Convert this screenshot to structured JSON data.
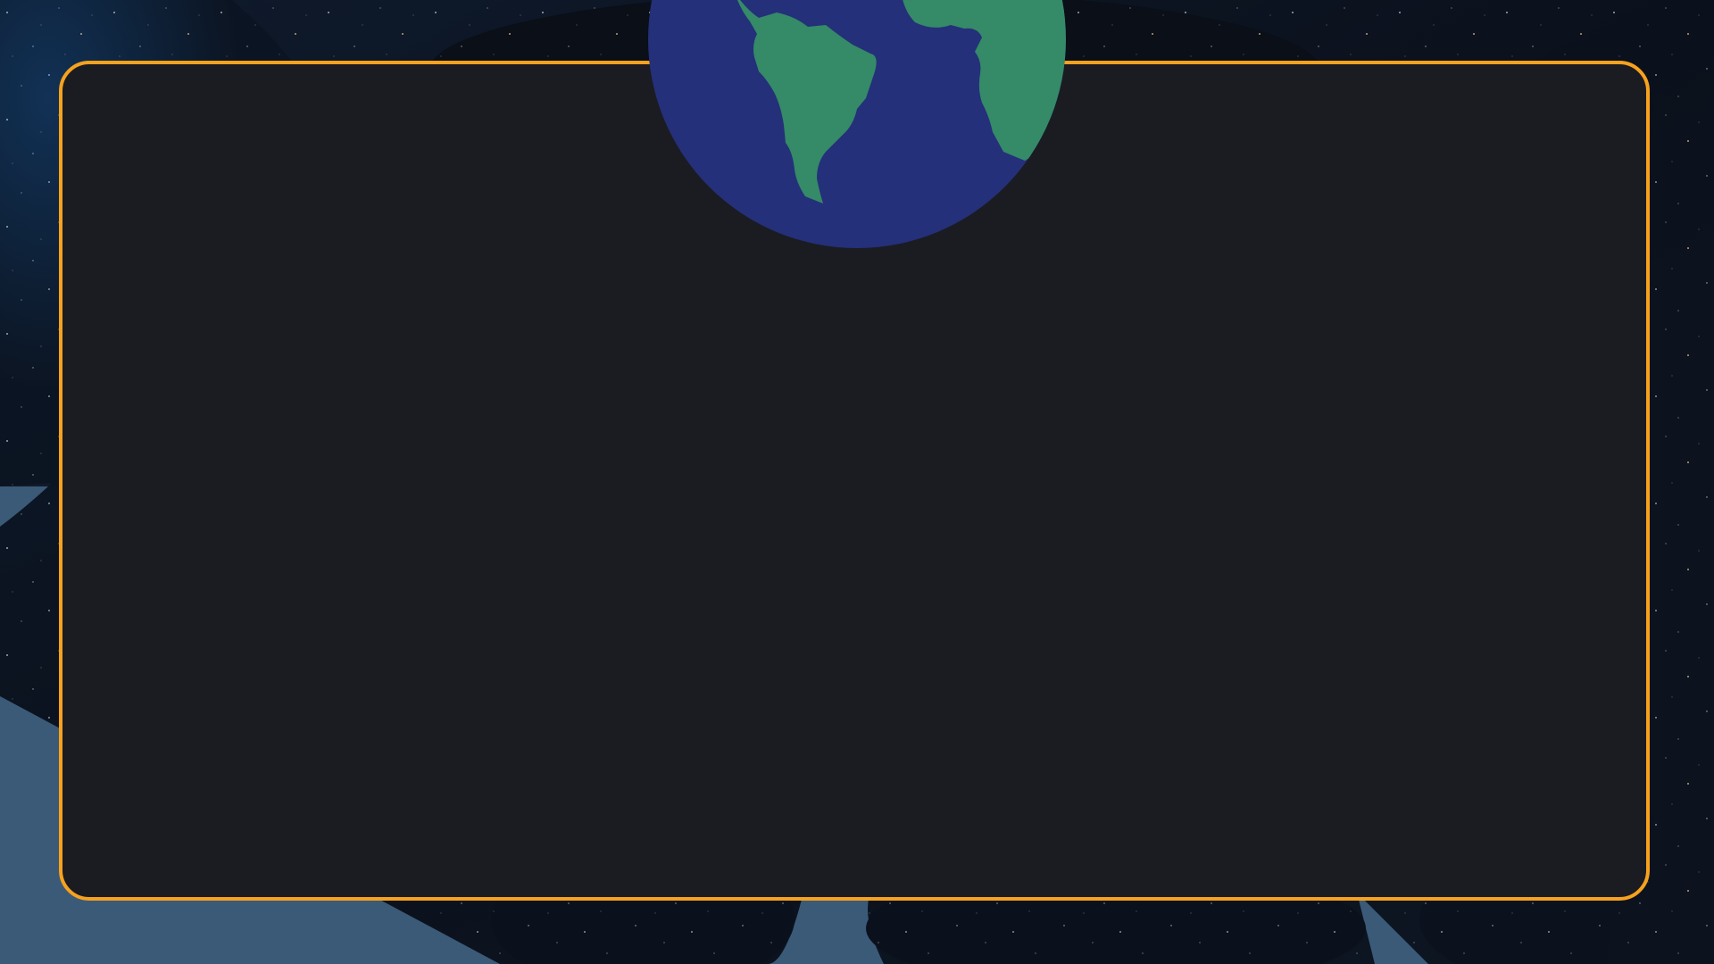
{
  "colors": {
    "background_lower": "#3a5a78",
    "space_dark": "#0b1421",
    "panel_fill": "#1b1b22",
    "panel_border": "#f6a21e",
    "earth_ocean": "#243079",
    "earth_land": "#358a68"
  },
  "decor": {
    "globe": "earth-globe-icon",
    "background": "starry-space-background"
  }
}
